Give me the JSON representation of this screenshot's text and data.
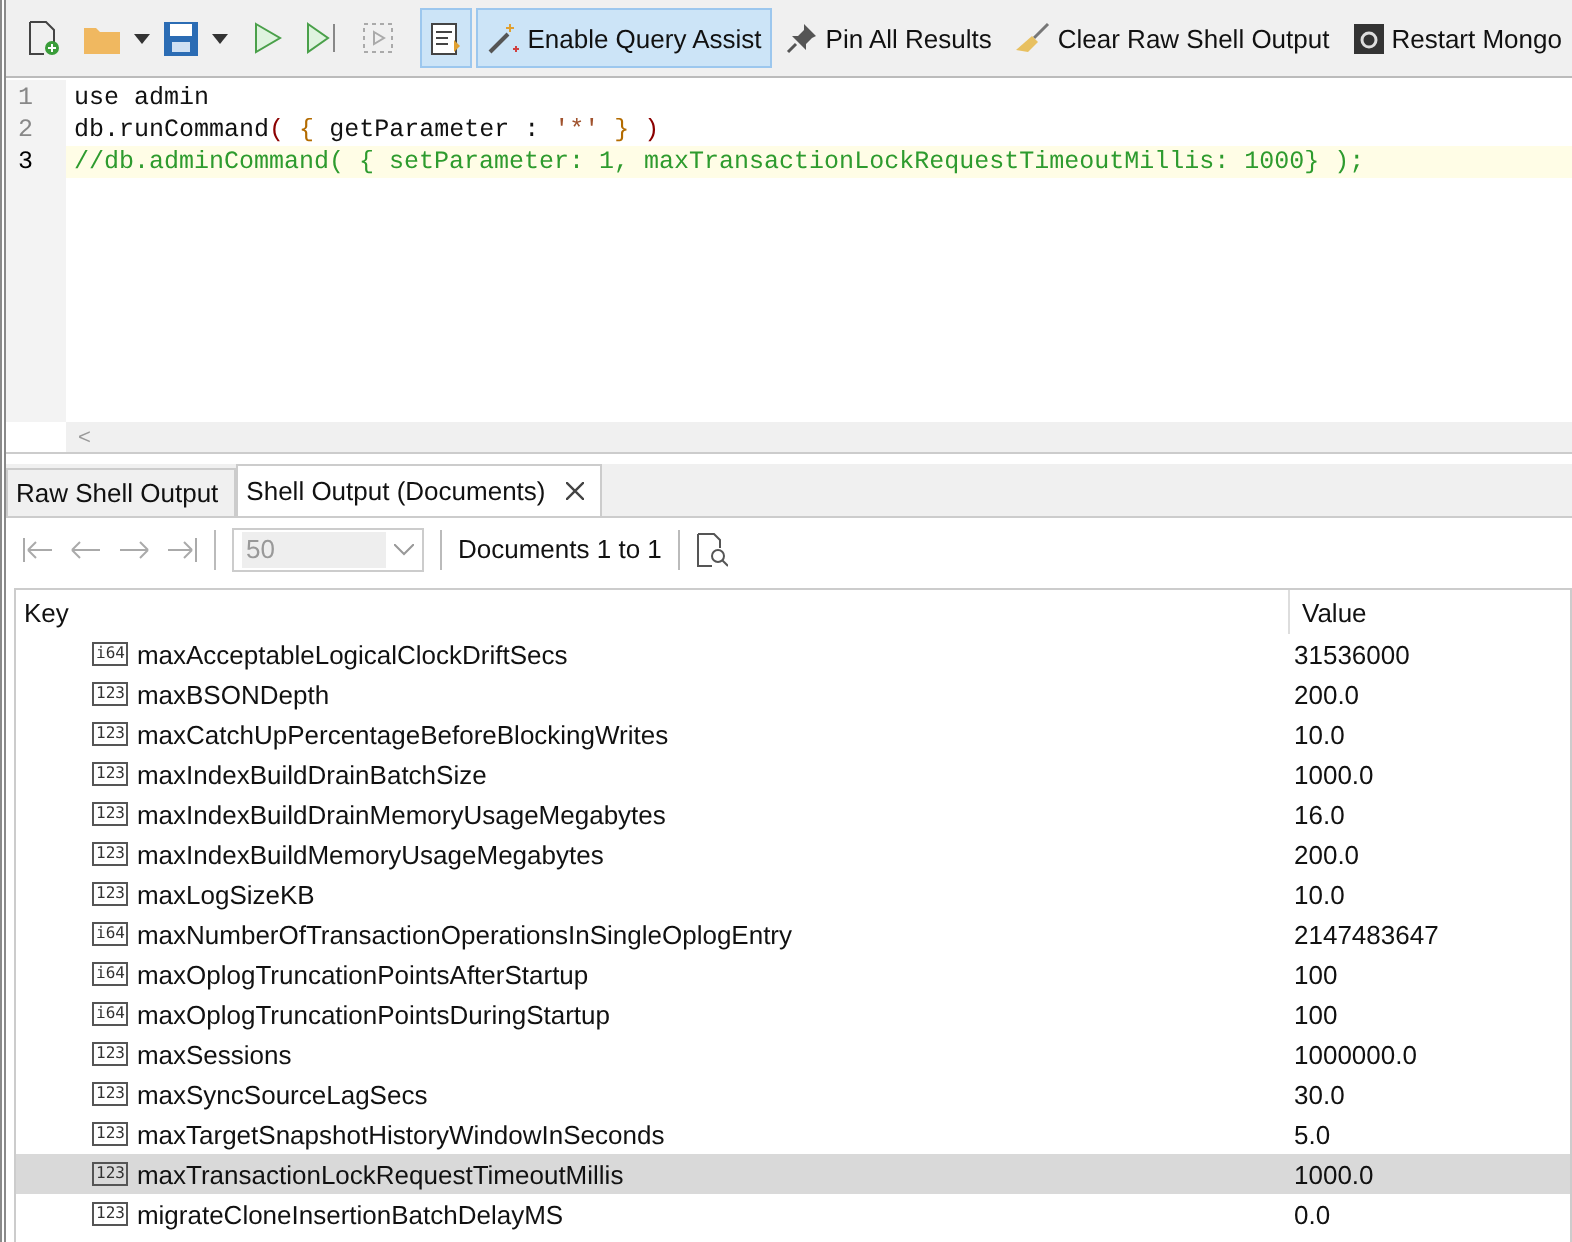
{
  "toolbar": {
    "buttons": [
      {
        "kind": "new",
        "selected": false
      },
      {
        "kind": "open",
        "selected": false
      },
      {
        "kind": "save",
        "selected": false
      },
      {
        "kind": "run",
        "selected": false
      },
      {
        "kind": "step",
        "selected": false
      },
      {
        "kind": "stepbox",
        "selected": false
      },
      {
        "kind": "assist-toggle",
        "selected": true
      },
      {
        "kind": "wand",
        "label": "Enable Query Assist",
        "selected": true
      },
      {
        "kind": "pin",
        "label": "Pin All Results",
        "selected": false
      },
      {
        "kind": "broom",
        "label": "Clear Raw Shell Output",
        "selected": false
      },
      {
        "kind": "restart",
        "label": "Restart Mongo",
        "selected": false
      }
    ]
  },
  "editor": {
    "lines": [
      {
        "number": "1",
        "current": false,
        "tokens": [
          {
            "kind": "plain",
            "text": "use admin"
          }
        ]
      },
      {
        "number": "2",
        "current": false,
        "tokens": [
          {
            "kind": "plain",
            "text": "db.runCommand"
          },
          {
            "kind": "paren",
            "text": "( "
          },
          {
            "kind": "brace",
            "text": "{ "
          },
          {
            "kind": "plain",
            "text": "getParameter : "
          },
          {
            "kind": "string",
            "text": "'*'"
          },
          {
            "kind": "brace",
            "text": " }"
          },
          {
            "kind": "paren",
            "text": " )"
          }
        ]
      },
      {
        "number": "3",
        "current": true,
        "tokens": [
          {
            "kind": "comment",
            "text": "//db.adminCommand( { setParameter: 1, maxTransactionLockRequestTimeoutMillis: 1000} );"
          }
        ]
      }
    ],
    "scroll_left": "<"
  },
  "tabs": [
    {
      "label": "Raw Shell Output",
      "selected": false,
      "closable": false
    },
    {
      "label": "Shell Output (Documents)",
      "selected": true,
      "closable": true
    }
  ],
  "pager": {
    "page_size": "50",
    "summary": "Documents 1 to 1"
  },
  "table": {
    "columns": [
      "Key",
      "Value"
    ],
    "rows": [
      {
        "type": "i64",
        "key": "maxAcceptableLogicalClockDriftSecs",
        "value": "31536000",
        "selected": false
      },
      {
        "type": "123",
        "key": "maxBSONDepth",
        "value": "200.0",
        "selected": false
      },
      {
        "type": "123",
        "key": "maxCatchUpPercentageBeforeBlockingWrites",
        "value": "10.0",
        "selected": false
      },
      {
        "type": "123",
        "key": "maxIndexBuildDrainBatchSize",
        "value": "1000.0",
        "selected": false
      },
      {
        "type": "123",
        "key": "maxIndexBuildDrainMemoryUsageMegabytes",
        "value": "16.0",
        "selected": false
      },
      {
        "type": "123",
        "key": "maxIndexBuildMemoryUsageMegabytes",
        "value": "200.0",
        "selected": false
      },
      {
        "type": "123",
        "key": "maxLogSizeKB",
        "value": "10.0",
        "selected": false
      },
      {
        "type": "i64",
        "key": "maxNumberOfTransactionOperationsInSingleOplogEntry",
        "value": "2147483647",
        "selected": false
      },
      {
        "type": "i64",
        "key": "maxOplogTruncationPointsAfterStartup",
        "value": "100",
        "selected": false
      },
      {
        "type": "i64",
        "key": "maxOplogTruncationPointsDuringStartup",
        "value": "100",
        "selected": false
      },
      {
        "type": "123",
        "key": "maxSessions",
        "value": "1000000.0",
        "selected": false
      },
      {
        "type": "123",
        "key": "maxSyncSourceLagSecs",
        "value": "30.0",
        "selected": false
      },
      {
        "type": "123",
        "key": "maxTargetSnapshotHistoryWindowInSeconds",
        "value": "5.0",
        "selected": false
      },
      {
        "type": "123",
        "key": "maxTransactionLockRequestTimeoutMillis",
        "value": "1000.0",
        "selected": true
      },
      {
        "type": "123",
        "key": "migrateCloneInsertionBatchDelayMS",
        "value": "0.0",
        "selected": false
      }
    ]
  }
}
